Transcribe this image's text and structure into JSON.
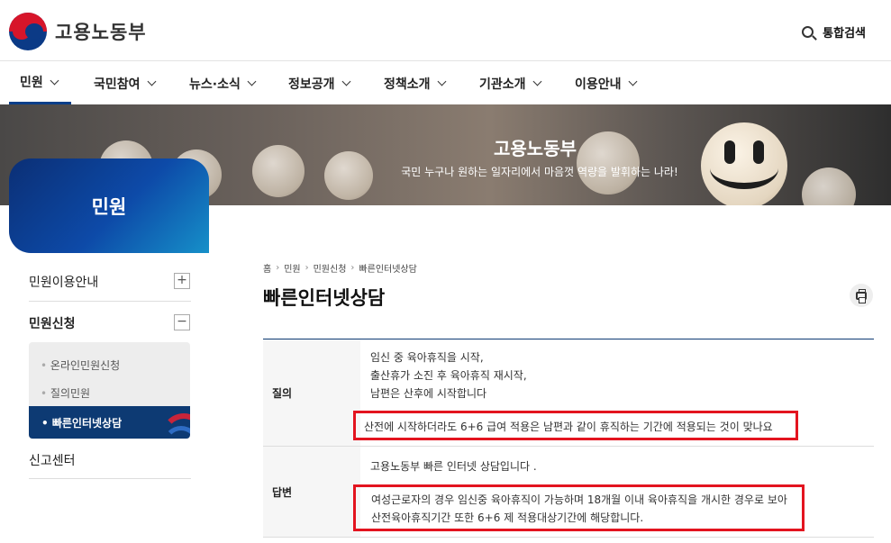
{
  "header": {
    "logo_text": "고용노동부",
    "search_label": "통합검색"
  },
  "gnb": [
    {
      "label": "민원"
    },
    {
      "label": "국민참여"
    },
    {
      "label": "뉴스·소식"
    },
    {
      "label": "정보공개"
    },
    {
      "label": "정책소개"
    },
    {
      "label": "기관소개"
    },
    {
      "label": "이용안내"
    }
  ],
  "banner": {
    "title": "고용노동부",
    "subtitle": "국민 누구나 원하는 일자리에서 마음껏 역량을 발휘하는 나라!"
  },
  "sidebar": {
    "title": "민원",
    "menu": [
      {
        "label": "민원이용안내",
        "toggle": "+"
      },
      {
        "label": "민원신청",
        "toggle": "−"
      },
      {
        "label": "신고센터"
      }
    ],
    "submenu": [
      {
        "label": "온라인민원신청"
      },
      {
        "label": "질의민원"
      },
      {
        "label": "• 빠른인터넷상담"
      }
    ]
  },
  "breadcrumb": [
    "홈",
    "민원",
    "민원신청",
    "빠른인터넷상담"
  ],
  "page_title": "빠른인터넷상담",
  "qa": {
    "question_label": "질의",
    "question_lines": [
      "임신 중 육아휴직을 시작,",
      "출산휴가 소진 후 육아휴직 재시작,",
      "남편은 산후에 시작합니다"
    ],
    "question_highlight": "산전에 시작하더라도 6+6 급여 적용은 남편과 같이 휴직하는 기간에 적용되는 것이 맞나요",
    "answer_label": "답변",
    "answer_intro": "고용노동부 빠른 인터넷 상담입니다 .",
    "answer_highlight_lines": [
      "여성근로자의 경우 임신중 육아휴직이 가능하며 18개월 이내 육아휴직을 개시한 경우로 보아",
      "산전육아휴직기간 또한 6+6 제 적용대상기간에 해당합니다."
    ]
  },
  "colors": {
    "brand_navy": "#0d3a73",
    "highlight_red": "#e3141f"
  }
}
